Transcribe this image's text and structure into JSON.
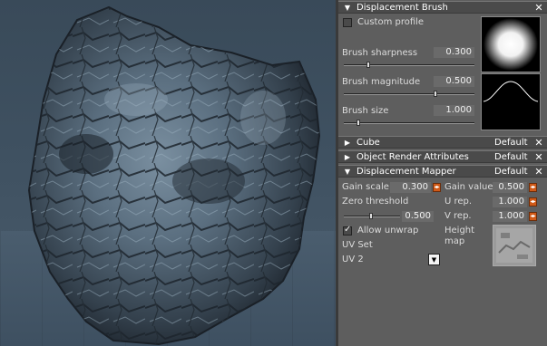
{
  "panel": {
    "displacement_brush": {
      "title": "Displacement Brush",
      "custom_profile_label": "Custom profile",
      "custom_profile_checked": false,
      "sharpness_label": "Brush sharpness",
      "sharpness_value": "0.300",
      "sharpness_fraction": 0.18,
      "magnitude_label": "Brush magnitude",
      "magnitude_value": "0.500",
      "magnitude_fraction": 0.72,
      "size_label": "Brush size",
      "size_value": "1.000",
      "size_fraction": 0.1
    },
    "sections": [
      {
        "title": "Cube",
        "default_label": "Default"
      },
      {
        "title": "Object Render Attributes",
        "default_label": "Default"
      }
    ],
    "displacement_mapper": {
      "title": "Displacement Mapper",
      "default_label": "Default",
      "gain_scale_label": "Gain scale",
      "gain_scale_value": "0.300",
      "gain_value_label": "Gain value",
      "gain_value_value": "0.500",
      "zero_threshold_label": "Zero threshold",
      "zero_threshold_value": "0.500",
      "zero_threshold_fraction": 0.5,
      "u_rep_label": "U rep.",
      "u_rep_value": "1.000",
      "v_rep_label": "V rep.",
      "v_rep_value": "1.000",
      "allow_unwrap_label": "Allow unwrap",
      "allow_unwrap_checked": true,
      "uv_set_label": "UV Set",
      "uv_set_value": "UV 2",
      "height_map_label": "Height map"
    }
  },
  "icons": {
    "collapse": "▼",
    "expand": "▶",
    "close": "✕",
    "spinner": "◀▶",
    "dropdown": "▼"
  },
  "colors": {
    "accent_spinner": "#d05a18",
    "panel_bg": "#5e5e5e",
    "header_bg": "#4a4a4a"
  }
}
